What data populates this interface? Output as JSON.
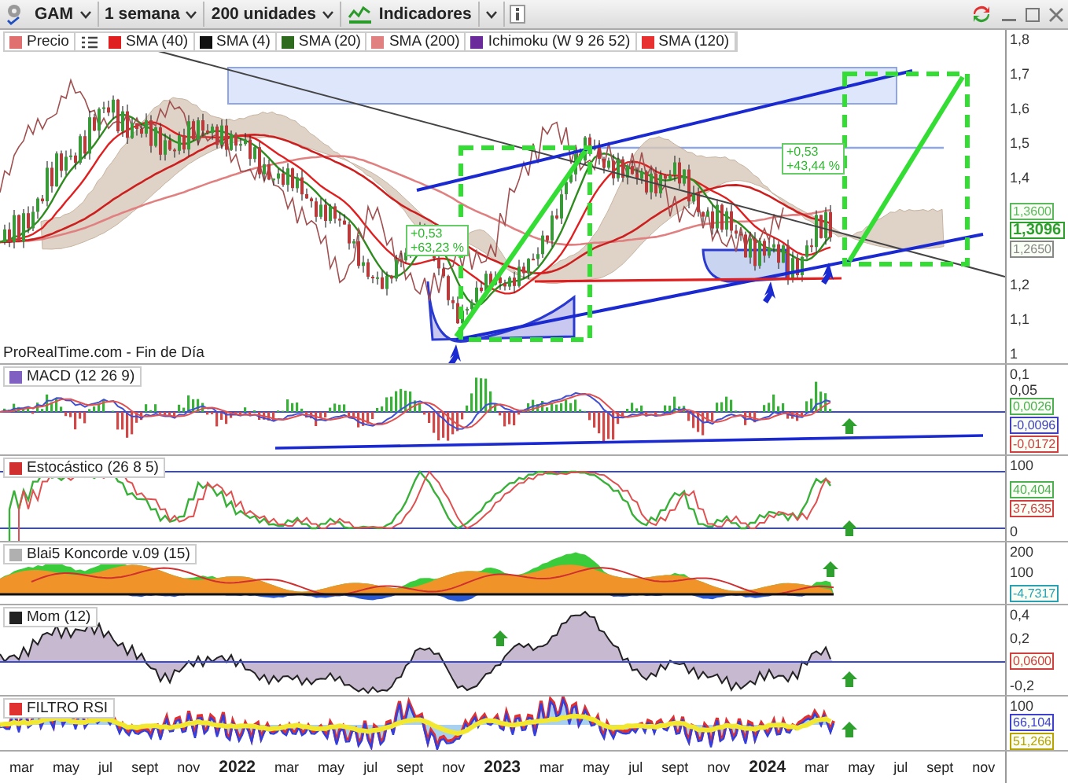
{
  "toolbar": {
    "symbol": "GAM",
    "period": "1 semana",
    "units": "200 unidades",
    "indicators": "Indicadores"
  },
  "legend": [
    {
      "label": "Precio",
      "color": "#e07070"
    },
    {
      "label": "SMA (40)",
      "color": "#e02020"
    },
    {
      "label": "SMA (4)",
      "color": "#111111"
    },
    {
      "label": "SMA (20)",
      "color": "#2e6b1e"
    },
    {
      "label": "SMA (200)",
      "color": "#e08080"
    },
    {
      "label": "Ichimoku (W 9 26 52)",
      "color": "#6a2a9a"
    },
    {
      "label": "SMA (120)",
      "color": "#e83030"
    }
  ],
  "main_chart": {
    "source": "ProRealTime.com - Fin de Día",
    "annotations": [
      {
        "lines": [
          "+0,53",
          "+63,23 %"
        ]
      },
      {
        "lines": [
          "+0,53",
          "+43,44 %"
        ]
      }
    ],
    "axis": [
      {
        "kind": "tick",
        "text": "1,8"
      },
      {
        "kind": "tick",
        "text": "1,7"
      },
      {
        "kind": "tick",
        "text": "1,6"
      },
      {
        "kind": "tick",
        "text": "1,5"
      },
      {
        "kind": "tick",
        "text": "1,4"
      },
      {
        "kind": "badges",
        "items": [
          {
            "text": "1,3600",
            "color": "#5cb85c",
            "primary": false
          },
          {
            "text": "1,3096",
            "color": "#2e9e2e",
            "primary": true
          },
          {
            "text": "1,2650",
            "color": "#888888",
            "primary": false
          }
        ]
      },
      {
        "kind": "tick",
        "text": "1,2"
      },
      {
        "kind": "tick",
        "text": "1,1"
      },
      {
        "kind": "tick",
        "text": "1"
      }
    ]
  },
  "panels": [
    {
      "kind": "macd",
      "title": "MACD (12 26 9)",
      "color": "#8060c0",
      "axis": [
        {
          "kind": "tick",
          "text": "0,1"
        },
        {
          "kind": "tick",
          "text": "0,05"
        },
        {
          "kind": "badges",
          "items": [
            {
              "text": "0,0026",
              "color": "#4caf50",
              "primary": false
            },
            {
              "text": "-0,0096",
              "color": "#4040c0",
              "primary": false
            },
            {
              "text": "-0,0172",
              "color": "#d04040",
              "primary": false
            }
          ]
        }
      ]
    },
    {
      "kind": "stochastic",
      "title": "Estocástico (26 8 5)",
      "color": "#d03030",
      "axis": [
        {
          "kind": "tick",
          "text": "100"
        },
        {
          "kind": "badges",
          "items": [
            {
              "text": "40,404",
              "color": "#4caf50",
              "primary": false
            },
            {
              "text": "37,635",
              "color": "#d04040",
              "primary": false
            }
          ]
        },
        {
          "kind": "tick",
          "text": "0"
        }
      ]
    },
    {
      "kind": "koncorde",
      "title": "Blai5 Koncorde v.09 (15)",
      "color": "#b0b0b0",
      "axis": [
        {
          "kind": "tick",
          "text": "200"
        },
        {
          "kind": "tick",
          "text": "100"
        },
        {
          "kind": "badges",
          "items": [
            {
              "text": "-4,7317",
              "color": "#2aa0b0",
              "primary": false
            }
          ]
        }
      ]
    },
    {
      "kind": "momentum",
      "title": "Mom (12)",
      "color": "#222222",
      "axis": [
        {
          "kind": "tick",
          "text": "0,4"
        },
        {
          "kind": "tick",
          "text": "0,2"
        },
        {
          "kind": "badges",
          "items": [
            {
              "text": "0,0600",
              "color": "#d04040",
              "primary": false
            }
          ]
        },
        {
          "kind": "tick",
          "text": "-0,2"
        }
      ]
    },
    {
      "kind": "rsi",
      "title": "FILTRO RSI",
      "color": "#e03030",
      "axis": [
        {
          "kind": "tick",
          "text": "100"
        },
        {
          "kind": "badges",
          "items": [
            {
              "text": "66,104",
              "color": "#4040d0",
              "primary": false
            },
            {
              "text": "51,266",
              "color": "#b8a400",
              "primary": false
            }
          ]
        }
      ]
    }
  ],
  "x_axis": [
    {
      "label": "mar",
      "kind": "month"
    },
    {
      "label": "may",
      "kind": "month"
    },
    {
      "label": "jul",
      "kind": "month"
    },
    {
      "label": "sept",
      "kind": "month"
    },
    {
      "label": "nov",
      "kind": "month"
    },
    {
      "label": "2022",
      "kind": "year"
    },
    {
      "label": "mar",
      "kind": "month"
    },
    {
      "label": "may",
      "kind": "month"
    },
    {
      "label": "jul",
      "kind": "month"
    },
    {
      "label": "sept",
      "kind": "month"
    },
    {
      "label": "nov",
      "kind": "month"
    },
    {
      "label": "2023",
      "kind": "year"
    },
    {
      "label": "mar",
      "kind": "month"
    },
    {
      "label": "may",
      "kind": "month"
    },
    {
      "label": "jul",
      "kind": "month"
    },
    {
      "label": "sept",
      "kind": "month"
    },
    {
      "label": "nov",
      "kind": "month"
    },
    {
      "label": "2024",
      "kind": "year"
    },
    {
      "label": "mar",
      "kind": "month"
    },
    {
      "label": "may",
      "kind": "month"
    },
    {
      "label": "jul",
      "kind": "month"
    },
    {
      "label": "sept",
      "kind": "month"
    },
    {
      "label": "nov",
      "kind": "month"
    }
  ]
}
